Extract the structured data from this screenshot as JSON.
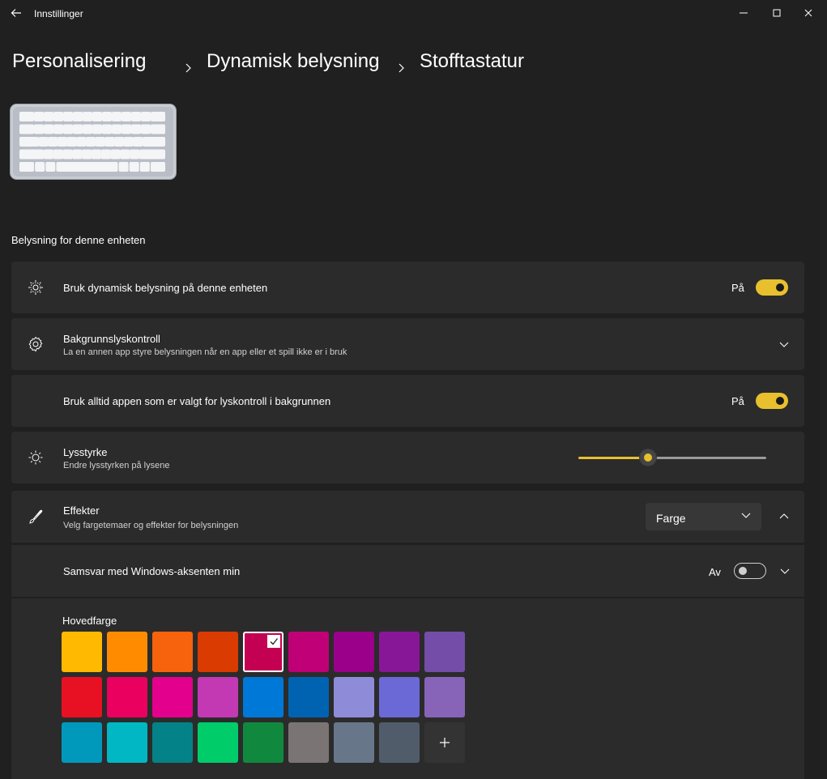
{
  "window": {
    "title": "Innstillinger"
  },
  "breadcrumb": [
    "Personalisering",
    "Dynamisk belysning",
    "Stofftastatur"
  ],
  "section_label": "Belysning for denne enheten",
  "rows": {
    "dynamic_lighting": {
      "title": "Bruk dynamisk belysning på denne enheten",
      "state": "På",
      "icon": "dynamic-lighting-icon"
    },
    "background_control": {
      "title": "Bakgrunnslyskontroll",
      "subtitle": "La en annen app styre belysningen når en app eller et spill ikke er i bruk",
      "icon": "gear-icon"
    },
    "always_use_app": {
      "title": "Bruk alltid appen som er valgt for lyskontroll i bakgrunnen",
      "state": "På"
    },
    "brightness": {
      "title": "Lysstyrke",
      "subtitle": "Endre lysstyrken på lysene",
      "value_fraction": 0.37,
      "icon": "brightness-icon"
    },
    "effects": {
      "title": "Effekter",
      "subtitle": "Velg fargetemaer og effekter for belysningen",
      "dropdown_value": "Farge",
      "icon": "brush-icon"
    },
    "accent_match": {
      "title": "Samsvar med Windows-aksenten min",
      "state": "Av"
    }
  },
  "main_color": {
    "label": "Hovedfarge",
    "swatches": [
      [
        "#ffb900",
        "#ff8c00",
        "#f7630c",
        "#da3b01",
        "#c30052",
        "#bf0077",
        "#9a0089",
        "#881798",
        "#744da9"
      ],
      [
        "#e81123",
        "#ea005e",
        "#e3008c",
        "#c239b3",
        "#0078d7",
        "#0063b1",
        "#8e8cd8",
        "#6b69d6",
        "#8764b8"
      ],
      [
        "#0099bc",
        "#00b7c3",
        "#038387",
        "#00cc6a",
        "#10893e",
        "#7a7574",
        "#68768a",
        "#515c6b"
      ]
    ],
    "selected": "#c30052"
  },
  "colors": {
    "accent": "#e8c02e",
    "background": "#202020",
    "card": "#2b2b2b"
  }
}
